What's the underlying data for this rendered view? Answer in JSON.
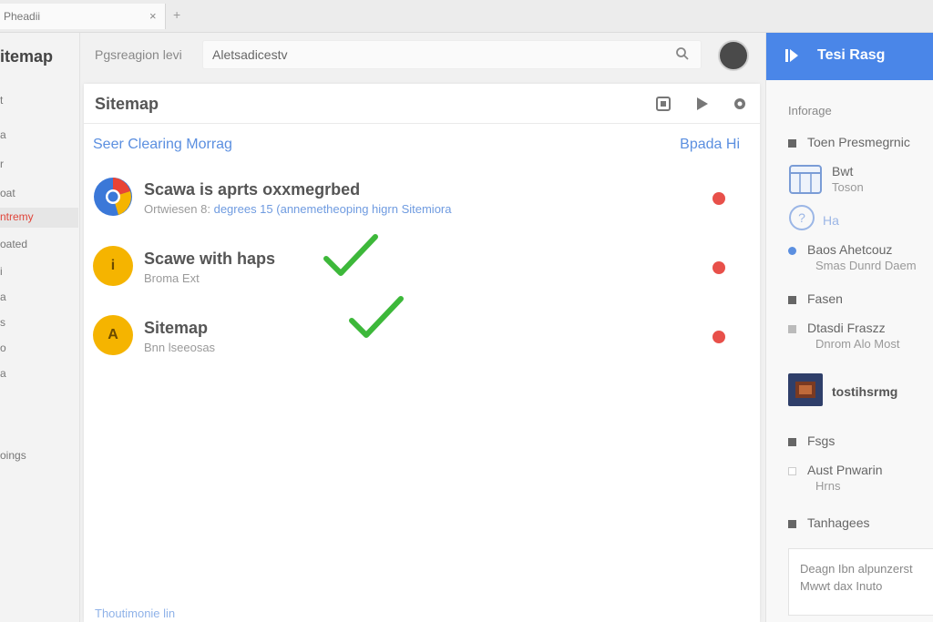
{
  "browser": {
    "tab_title": "Pheadii",
    "tab_close": "×",
    "new_tab": "+"
  },
  "sidebar": {
    "app_title": "itemap",
    "items": [
      {
        "label": "t"
      },
      {
        "label": "a"
      },
      {
        "label": "r"
      },
      {
        "label": "oat"
      },
      {
        "label": "ntremy",
        "active": true
      },
      {
        "label": "oated"
      },
      {
        "label": "i"
      },
      {
        "label": "a"
      },
      {
        "label": "s"
      },
      {
        "label": "o"
      },
      {
        "label": "a"
      },
      {
        "label": "oings"
      }
    ]
  },
  "search": {
    "label": "Pgsreagion levi",
    "value": "Aletsadicestv",
    "icon": "search-icon"
  },
  "main": {
    "title": "Sitemap",
    "header_icons": [
      "grid-icon",
      "play-icon",
      "settings-icon"
    ],
    "section_link": "Seer Clearing Morrag",
    "section_action": "Bpada Hi",
    "items": [
      {
        "title": "Scawa is aprts oxxmegrbed",
        "subtitle_prefix": "Ortwiesen 8: ",
        "subtitle_link": "degrees 15 (annemetheoping higrn Sitemiora",
        "avatar_icon": "chrome-logo-icon",
        "avatar_color": "#3b78d8",
        "checked": false
      },
      {
        "title": "Scawe with haps",
        "subtitle_prefix": "Broma Ext",
        "subtitle_link": "",
        "avatar_text": "i",
        "avatar_color": "#f5b400",
        "checked": true
      },
      {
        "title": "Sitemap",
        "subtitle_prefix": "Bnn lseeosas",
        "subtitle_link": "",
        "avatar_text": "A",
        "avatar_color": "#f5b400",
        "checked": true
      }
    ],
    "footer_link": "Thoutimonie lin"
  },
  "right_panel": {
    "primary_button": "Tesi Rasg",
    "heading": "Inforage",
    "rows": [
      {
        "label": "Toen Presmegrnic"
      },
      {
        "label": "Bwt",
        "sub": "Toson"
      },
      {
        "label": "Ha"
      },
      {
        "label": "Baos Ahetcouz",
        "sub": "Smas Dunrd Daem"
      },
      {
        "label": "Fasen"
      },
      {
        "label": "Dtasdi Fraszz",
        "sub": "Dnrom Alo Most"
      },
      {
        "label": "tostihsrmg"
      },
      {
        "label": "Fsgs"
      },
      {
        "label": "Aust Pnwarin",
        "sub": "Hrns"
      },
      {
        "label": "Tanhagees"
      }
    ],
    "textarea": "Deagn Ibn alpunzerst Mwwt dax Inuto"
  },
  "colors": {
    "accent": "#4a86e8",
    "link": "#5b8fe0",
    "status_red": "#e8504a",
    "check_green": "#3db83a",
    "avatar_yellow": "#f5b400"
  }
}
